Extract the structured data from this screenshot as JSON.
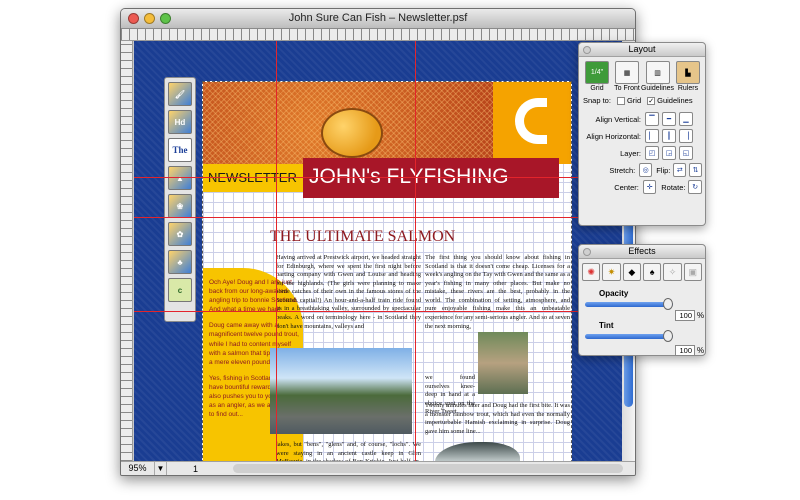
{
  "window": {
    "title": "John Sure Can Fish – Newsletter.psf",
    "zoom": "95%",
    "page_number": "1"
  },
  "tools": [
    "paint",
    "heading",
    "text",
    "shapes",
    "clipart",
    "bullets",
    "photos",
    "custom"
  ],
  "newsletter": {
    "label": "NEWSLETTER",
    "masthead": "JOHN's FLYFISHING",
    "headline": "THE ULTIMATE SALMON",
    "sidebar_paragraphs": [
      "Och Aye! Doug and I are just back from our long-awaited angling trip to bonnie Scotland. And what a time we had!",
      "Doug came away with a magnificent twelve pound trout, while I had to content myself with a salmon that tipped in at a mere eleven pounds!",
      "Yes, fishing in Scotland can have bountiful rewards, but it also pushes you to your limits as an angler, as we are going to find out..."
    ],
    "col1_top": "Having arrived at Prestwick airport, we headed straight for Edinburgh, where we spent the first night before parting company with Gwen and Louise and heading for the highlands. (The girls were planning to make some catches of their own in the famous stores of the Scottish capital!) An hour-and-a-half train ride found us in a breathtaking valley, surrounded by spectacular peaks. A word on terminology here - in Scotland they don't have mountains, valleys and",
    "col1_bottom": "lakes, but \"bens\", \"glens\" and, of course, \"lochs\". We were staying in an ancient castle keep in Glen McBourie, in the shadow of Ben Krickie. Just half-an-hour's drive from the famous Loch Dullard. At the station to meet us was our guide for the next ten days, the redoubtable Hamish.",
    "col2_top": "The first thing you should know about fishing in Scotland is that it doesn't come cheap. Licenses for a week's angling on the Tay with Gwen and the same as a year's fishing in many other places. But make no mistake, these rivers are the best, probably in the world. The combination of setting, atmosphere, and pure enjoyable fishing make this an unbeatable experience for any semi-serious angler. And so at seven the next morning,",
    "col2_mid": "we found ourselves knee-deep in hand at a choice spot on the River Tweet.",
    "col2_bottom": "Twenty minutes later and Doug had the first bite. It was a monster rainbow trout, which had even the normally imperturbable Hamish exclaiming in surprise. Doug gave him some line..."
  },
  "layout_panel": {
    "title": "Layout",
    "buttons": [
      "Grid",
      "To Front",
      "Guidelines",
      "Rulers"
    ],
    "grid_badge": "1/4\"",
    "snap_to": "Snap to:",
    "snap_grid": "Grid",
    "snap_guidelines": "Guidelines",
    "rows": [
      "Align Vertical:",
      "Align Horizontal:",
      "Layer:",
      "Stretch:",
      "Center:"
    ],
    "flip": "Flip:",
    "rotate": "Rotate:"
  },
  "effects_panel": {
    "title": "Effects",
    "opacity_label": "Opacity",
    "opacity_value": "100",
    "tint_label": "Tint",
    "tint_value": "100",
    "percent": "%"
  },
  "colors": {
    "accent": "#a81628",
    "yellow": "#f7c400",
    "canvas": "#1a3d92",
    "guide": "#e3242b"
  }
}
